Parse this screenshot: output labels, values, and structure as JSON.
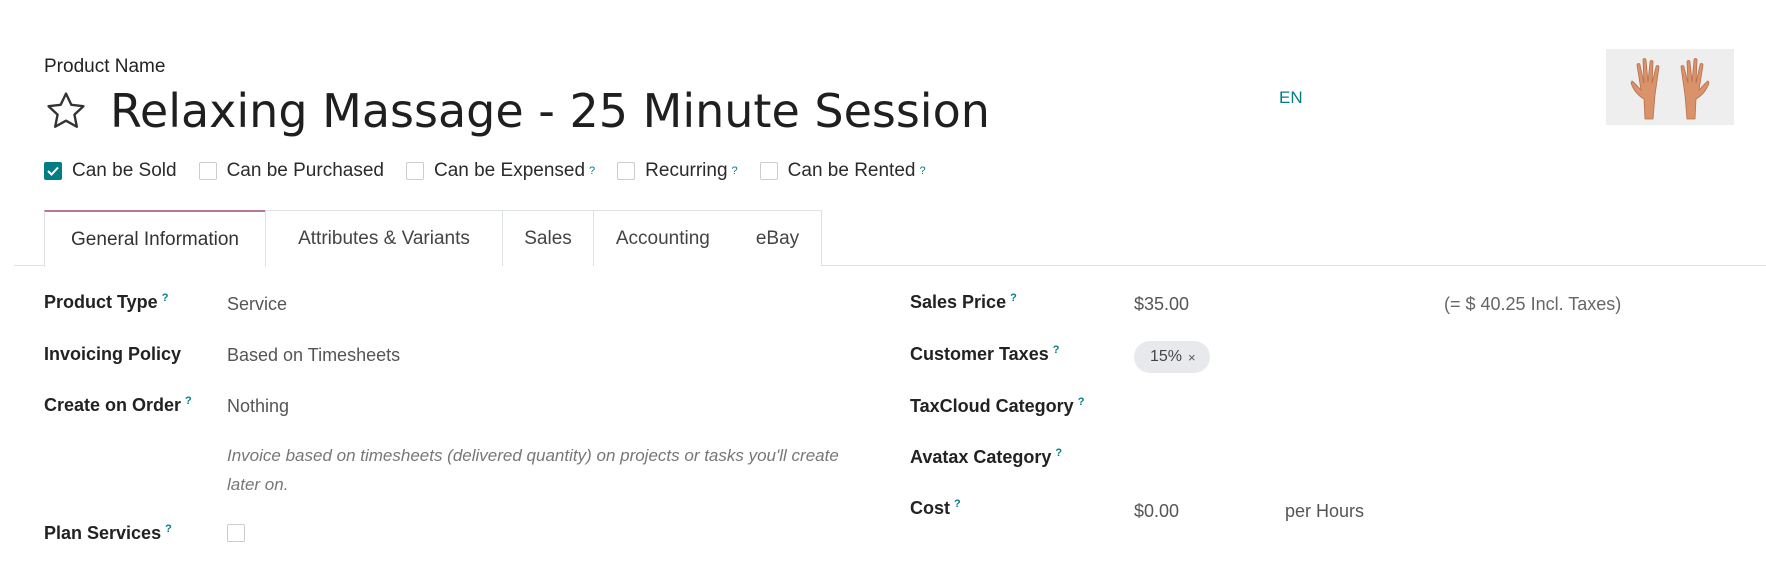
{
  "header": {
    "product_name_label": "Product Name",
    "title": "Relaxing Massage - 25 Minute Session",
    "language": "EN",
    "image_icon": "hands-image"
  },
  "checkboxes": [
    {
      "label": "Can be Sold",
      "checked": true,
      "help": false
    },
    {
      "label": "Can be Purchased",
      "checked": false,
      "help": false
    },
    {
      "label": "Can be Expensed",
      "checked": false,
      "help": true
    },
    {
      "label": "Recurring",
      "checked": false,
      "help": true
    },
    {
      "label": "Can be Rented",
      "checked": false,
      "help": true
    }
  ],
  "help_mark": "?",
  "tabs": [
    {
      "label": "General Information",
      "active": true
    },
    {
      "label": "Attributes & Variants",
      "active": false
    },
    {
      "label": "Sales",
      "active": false
    },
    {
      "label": "Accounting",
      "active": false
    },
    {
      "label": "eBay",
      "active": false
    }
  ],
  "left_fields": {
    "product_type": {
      "label": "Product Type",
      "value": "Service"
    },
    "invoicing_policy": {
      "label": "Invoicing Policy",
      "value": "Based on Timesheets"
    },
    "create_on_order": {
      "label": "Create on Order",
      "value": "Nothing"
    },
    "invoice_help": "Invoice based on timesheets (delivered quantity) on projects or tasks you'll create later on.",
    "plan_services": {
      "label": "Plan Services",
      "checked": false
    }
  },
  "right_fields": {
    "sales_price": {
      "label": "Sales Price",
      "value": "$35.00",
      "incl_taxes": "(= $ 40.25 Incl. Taxes)"
    },
    "customer_taxes": {
      "label": "Customer Taxes",
      "tag": "15%",
      "tag_remove": "×"
    },
    "taxcloud_category": {
      "label": "TaxCloud Category"
    },
    "avatax_category": {
      "label": "Avatax Category"
    },
    "cost": {
      "label": "Cost",
      "value": "$0.00",
      "unit": "per Hours"
    }
  },
  "colors": {
    "accent": "#017e84",
    "active_tab_border": "#b5779e",
    "tag_bg": "#e7e9ed"
  }
}
